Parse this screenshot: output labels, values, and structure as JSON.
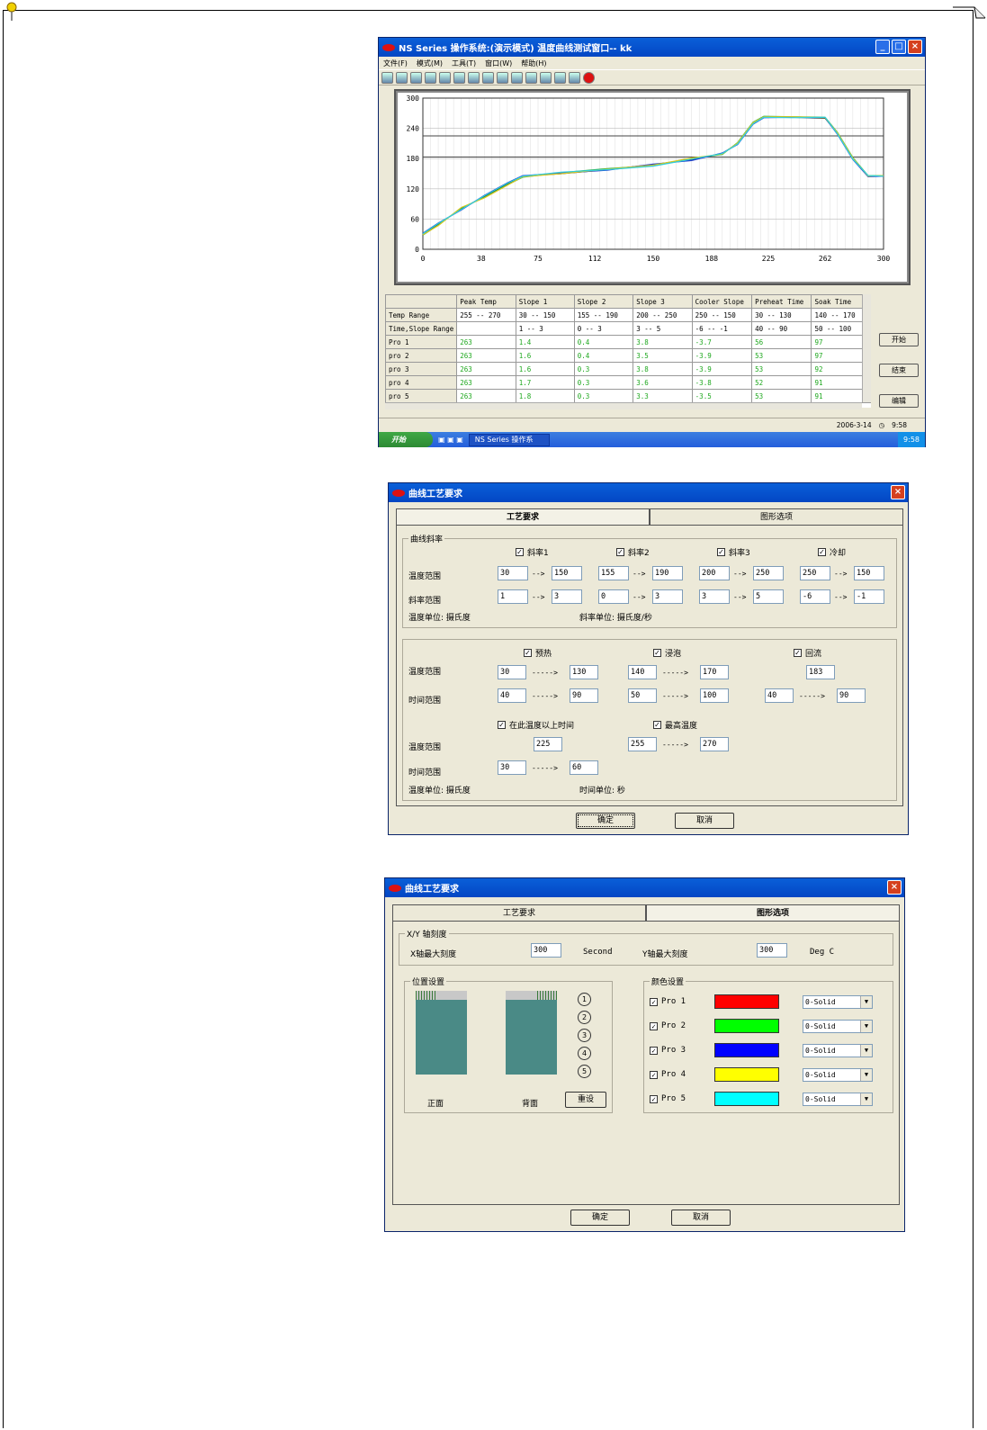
{
  "main_window": {
    "title": "NS Series 操作系统:(演示模式) 温度曲线测试窗口-- kk",
    "menu": [
      "文件(F)",
      "模式(M)",
      "工具(T)",
      "窗口(W)",
      "帮助(H)"
    ],
    "table": {
      "headers": [
        "",
        "Peak Temp",
        "Slope 1",
        "Slope 2",
        "Slope 3",
        "Cooler Slope",
        "Preheat Time",
        "Soak Time"
      ],
      "range_rows": [
        [
          "Temp Range",
          "255 -- 270",
          "30 -- 150",
          "155 -- 190",
          "200 -- 250",
          "250 -- 150",
          "30 -- 130",
          "140 -- 170"
        ],
        [
          "Time,Slope Range",
          "",
          "1 -- 3",
          "0 -- 3",
          "3 -- 5",
          "-6 -- -1",
          "40 -- 90",
          "50 -- 100"
        ]
      ],
      "pro_rows": [
        [
          "Pro 1",
          "263",
          "1.4",
          "0.4",
          "3.8",
          "-3.7",
          "56",
          "97"
        ],
        [
          "pro 2",
          "263",
          "1.6",
          "0.4",
          "3.5",
          "-3.9",
          "53",
          "97"
        ],
        [
          "pro 3",
          "263",
          "1.6",
          "0.3",
          "3.8",
          "-3.9",
          "53",
          "92"
        ],
        [
          "pro 4",
          "263",
          "1.7",
          "0.3",
          "3.6",
          "-3.8",
          "52",
          "91"
        ],
        [
          "pro 5",
          "263",
          "1.8",
          "0.3",
          "3.3",
          "-3.5",
          "53",
          "91"
        ]
      ]
    },
    "side_buttons": [
      "开始",
      "结束",
      "编辑"
    ],
    "status_date": "2006-3-14",
    "status_time": "9:58",
    "taskbar": {
      "start": "开始",
      "task": "NS Series 操作系",
      "clock": "9:58"
    }
  },
  "chart_data": {
    "type": "line",
    "x_ticks": [
      "0",
      "38",
      "75",
      "112",
      "150",
      "188",
      "225",
      "262",
      "300"
    ],
    "y_ticks": [
      "300",
      "240",
      "180",
      "120",
      "60",
      "0"
    ],
    "xlim": [
      0,
      300
    ],
    "ylim": [
      0,
      300
    ],
    "grid": true,
    "reference_lines": [
      225,
      183
    ],
    "series": [
      {
        "color": "#1a1a1a",
        "x": [
          0,
          10,
          25,
          40,
          55,
          65,
          90,
          120,
          150,
          175,
          195,
          205,
          215,
          222,
          240,
          262,
          270,
          280,
          290,
          300
        ],
        "y": [
          30,
          50,
          80,
          105,
          130,
          145,
          150,
          158,
          168,
          178,
          190,
          210,
          250,
          262,
          262,
          260,
          230,
          180,
          145,
          145
        ]
      },
      {
        "color": "#2ab04a",
        "x": [
          0,
          10,
          25,
          40,
          55,
          65,
          90,
          120,
          150,
          175,
          195,
          205,
          215,
          222,
          240,
          262,
          270,
          280,
          290,
          300
        ],
        "y": [
          28,
          48,
          82,
          103,
          128,
          143,
          152,
          160,
          166,
          180,
          188,
          212,
          252,
          264,
          263,
          262,
          232,
          182,
          146,
          146
        ]
      },
      {
        "color": "#2040d0",
        "x": [
          0,
          10,
          25,
          40,
          55,
          65,
          90,
          120,
          150,
          175,
          195,
          205,
          215,
          222,
          240,
          262,
          270,
          280,
          290,
          300
        ],
        "y": [
          32,
          52,
          78,
          107,
          132,
          146,
          151,
          157,
          169,
          176,
          191,
          208,
          248,
          261,
          262,
          261,
          228,
          178,
          144,
          145
        ]
      },
      {
        "color": "#d8c820",
        "x": [
          0,
          10,
          25,
          40,
          55,
          65,
          90,
          120,
          150,
          175,
          195,
          205,
          215,
          222,
          240,
          262,
          270,
          280,
          290,
          300
        ],
        "y": [
          29,
          47,
          83,
          102,
          127,
          144,
          150,
          159,
          167,
          181,
          189,
          211,
          251,
          263,
          263,
          261,
          231,
          181,
          145,
          146
        ]
      },
      {
        "color": "#30d0e0",
        "x": [
          0,
          10,
          25,
          40,
          55,
          65,
          90,
          120,
          150,
          175,
          195,
          205,
          215,
          222,
          240,
          262,
          270,
          280,
          290,
          300
        ],
        "y": [
          31,
          51,
          79,
          106,
          131,
          145,
          153,
          158,
          165,
          179,
          190,
          209,
          249,
          262,
          261,
          262,
          229,
          179,
          146,
          145
        ]
      }
    ]
  },
  "dialog1": {
    "title": "曲线工艺要求",
    "tabs": [
      "工艺要求",
      "图形选项"
    ],
    "slope_group": {
      "label": "曲线斜率",
      "checks": [
        "斜率1",
        "斜率2",
        "斜率3",
        "冷却"
      ],
      "row_labels": [
        "温度范围",
        "斜率范围"
      ],
      "temp_values": [
        [
          "30",
          "150"
        ],
        [
          "155",
          "190"
        ],
        [
          "200",
          "250"
        ],
        [
          "250",
          "150"
        ]
      ],
      "slope_values": [
        [
          "1",
          "3"
        ],
        [
          "0",
          "3"
        ],
        [
          "3",
          "5"
        ],
        [
          "-6",
          "-1"
        ]
      ],
      "arrow": "-->",
      "temp_unit": "温度单位: 摄氏度",
      "slope_unit": "斜率单位: 摄氏度/秒"
    },
    "time_group": {
      "checks": [
        "预热",
        "浸泡",
        "回流"
      ],
      "row_labels": [
        "温度范围",
        "时间范围"
      ],
      "preheat": {
        "temp": [
          "30",
          "130"
        ],
        "time": [
          "40",
          "90"
        ]
      },
      "soak": {
        "temp": [
          "140",
          "170"
        ],
        "time": [
          "50",
          "100"
        ]
      },
      "reflow": {
        "temp": "183",
        "time": [
          "40",
          "90"
        ]
      },
      "arrow": "----->",
      "checks2": [
        "在此温度以上时间",
        "最高温度"
      ],
      "above": {
        "temp": "225",
        "time": [
          "30",
          "60"
        ]
      },
      "peak": {
        "temp": [
          "255",
          "270"
        ]
      },
      "row_labels2": [
        "温度范围",
        "时间范围"
      ],
      "temp_unit": "温度单位: 摄氏度",
      "time_unit": "时间单位:  秒"
    },
    "ok": "确定",
    "cancel": "取消"
  },
  "dialog2": {
    "title": "曲线工艺要求",
    "tabs": [
      "工艺要求",
      "图形选项"
    ],
    "axis_group": {
      "label": "X/Y 轴刻度",
      "x_label": "X轴最大刻度",
      "x_value": "300",
      "x_unit": "Second",
      "y_label": "Y轴最大刻度",
      "y_value": "300",
      "y_unit": "Deg C"
    },
    "position_group": {
      "label": "位置设置",
      "front": "正面",
      "back": "背面",
      "reset": "重设",
      "circles": [
        "1",
        "2",
        "3",
        "4",
        "5"
      ]
    },
    "color_group": {
      "label": "颜色设置",
      "items": [
        {
          "name": "Pro 1",
          "color": "#ff0000",
          "style": "0-Solid"
        },
        {
          "name": "Pro 2",
          "color": "#00ff00",
          "style": "0-Solid"
        },
        {
          "name": "Pro 3",
          "color": "#0000ff",
          "style": "0-Solid"
        },
        {
          "name": "Pro 4",
          "color": "#ffff00",
          "style": "0-Solid"
        },
        {
          "name": "Pro 5",
          "color": "#00ffff",
          "style": "0-Solid"
        }
      ]
    },
    "ok": "确定",
    "cancel": "取消"
  }
}
